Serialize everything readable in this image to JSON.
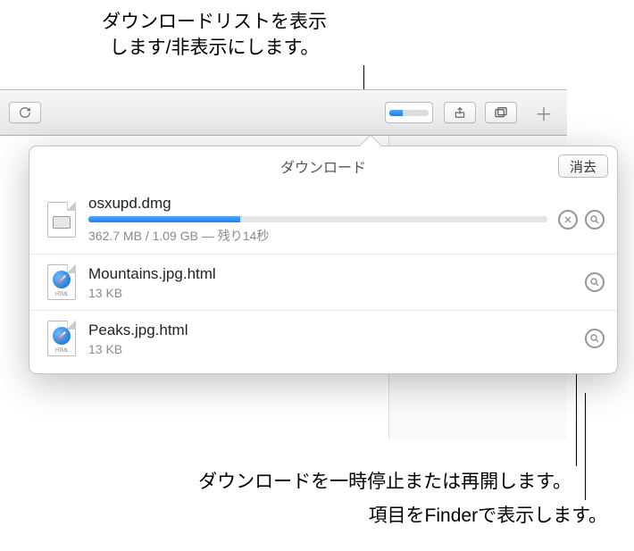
{
  "annotations": {
    "top": "ダウンロードリストを表示\nします/非表示にします。",
    "mid": "ダウンロードを一時停止または再開します。",
    "bot": "項目をFinderで表示します。"
  },
  "toolbar": {
    "reload_name": "reload-icon",
    "downloads_progress_pct": 35,
    "share_name": "share-icon",
    "tabs_name": "tabs-icon",
    "addtab_label": "＋"
  },
  "popover": {
    "title": "ダウンロード",
    "clear_label": "消去"
  },
  "downloads": [
    {
      "name": "osxupd.dmg",
      "meta": "362.7 MB / 1.09 GB — 残り14秒",
      "type": "dmg",
      "progress_pct": 33,
      "in_progress": true
    },
    {
      "name": "Mountains.jpg.html",
      "meta": "13 KB",
      "type": "html",
      "in_progress": false
    },
    {
      "name": "Peaks.jpg.html",
      "meta": "13 KB",
      "type": "html",
      "in_progress": false
    }
  ]
}
